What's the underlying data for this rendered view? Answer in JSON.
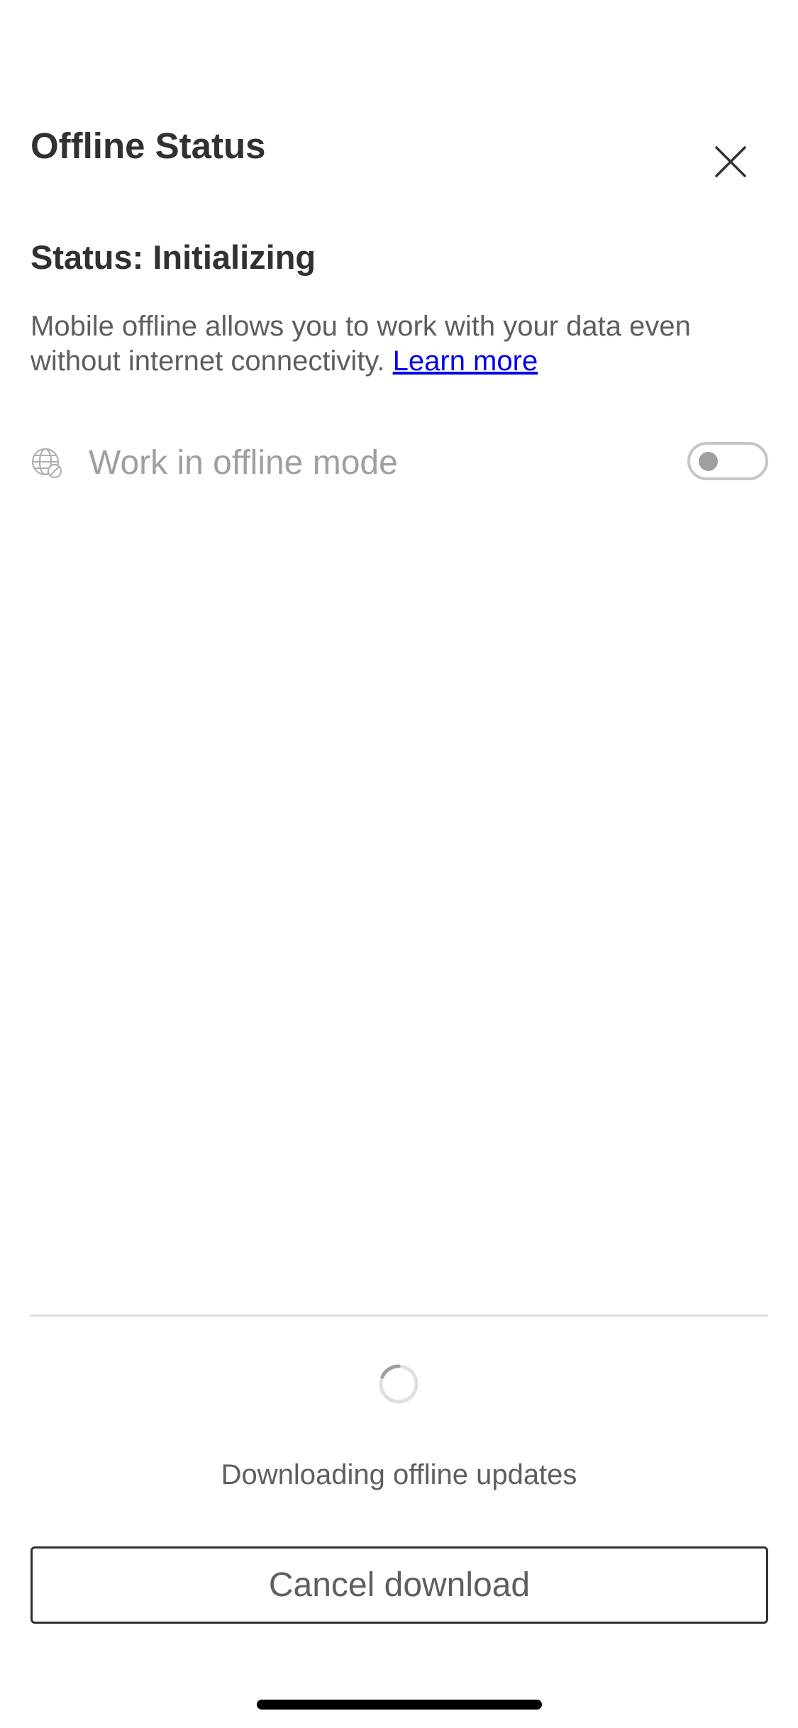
{
  "header": {
    "title": "Offline Status"
  },
  "status": {
    "heading": "Status: Initializing",
    "description": "Mobile offline allows you to work with your data even without internet connectivity.",
    "learn_more_label": "Learn more"
  },
  "offline_mode": {
    "label": "Work in offline mode",
    "icon": "globe-offline-icon",
    "enabled": false
  },
  "download": {
    "progress_text": "Downloading offline updates",
    "cancel_label": "Cancel download"
  },
  "colors": {
    "text_primary": "#323130",
    "text_secondary": "#605e5c",
    "text_disabled": "#a19f9d",
    "link": "#0000ee",
    "divider": "#dddddd"
  }
}
